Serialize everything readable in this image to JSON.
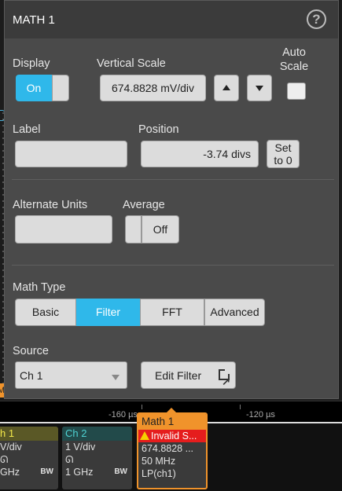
{
  "dialog": {
    "title": "MATH 1",
    "help_symbol": "?",
    "display": {
      "label": "Display",
      "value": "On"
    },
    "vertical_scale": {
      "label": "Vertical Scale",
      "value": "674.8828 mV/div"
    },
    "auto_scale": {
      "label_line1": "Auto",
      "label_line2": "Scale",
      "checked": false
    },
    "label_field": {
      "label": "Label",
      "value": ""
    },
    "position": {
      "label": "Position",
      "value": "-3.74 divs",
      "set_to_zero_line1": "Set",
      "set_to_zero_line2": "to 0"
    },
    "alternate_units": {
      "label": "Alternate Units",
      "value": ""
    },
    "average": {
      "label": "Average",
      "value": "Off"
    },
    "math_type": {
      "label": "Math Type",
      "options": [
        "Basic",
        "Filter",
        "FFT",
        "Advanced"
      ],
      "selected": "Filter"
    },
    "source": {
      "label": "Source",
      "value": "Ch 1"
    },
    "edit_filter": {
      "label": "Edit Filter"
    }
  },
  "time_axis": {
    "labels": [
      "-160 µs",
      "-120 µs"
    ]
  },
  "channels": {
    "ch1": {
      "name": "h 1",
      "scale": "V/div",
      "bandwidth": "GHz",
      "bw_tag": "BW"
    },
    "ch2": {
      "name": "Ch 2",
      "scale": "1 V/div",
      "bandwidth": "1 GHz",
      "bw_tag": "BW"
    },
    "math1": {
      "name": "Math 1",
      "status": "Invalid S...",
      "scale": "674.8828 ...",
      "bandwidth": "50 MHz",
      "filter": "LP(ch1)"
    }
  },
  "colors": {
    "accent": "#2fb8ea",
    "math": "#f0932b",
    "ch1": "#f2e84a",
    "ch2": "#4fd2d2",
    "error": "#e51d1d"
  },
  "left_marker": "M"
}
